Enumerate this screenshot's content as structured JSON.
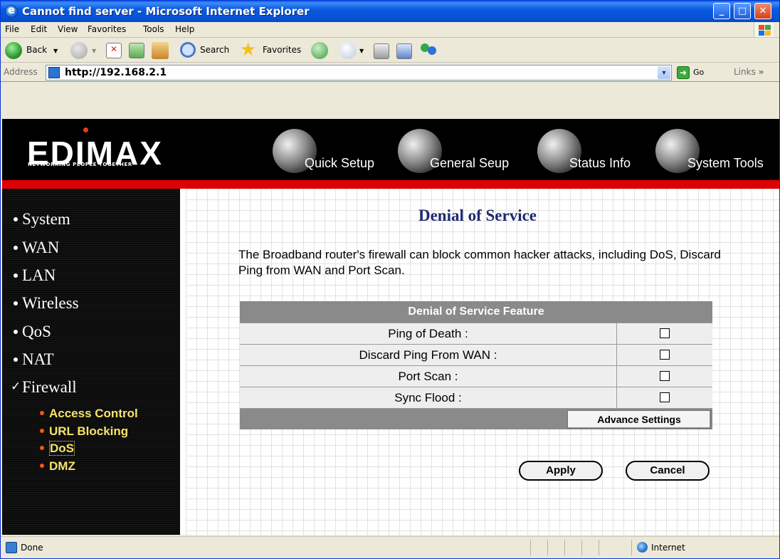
{
  "window": {
    "title": "Cannot find server - Microsoft Internet Explorer"
  },
  "menu": [
    "File",
    "Edit",
    "View",
    "Favorites",
    "Tools",
    "Help"
  ],
  "toolbar": {
    "back": "Back",
    "search": "Search",
    "favorites": "Favorites"
  },
  "address": {
    "label": "Address",
    "url": "http://192.168.2.1",
    "go": "Go",
    "links": "Links"
  },
  "router": {
    "logo": "EDIMAX",
    "tagline": "NETWORKING PEOPLE TOGETHER",
    "nav": [
      "Quick Setup",
      "General Seup",
      "Status Info",
      "System Tools"
    ]
  },
  "sidebar": {
    "items": [
      "System",
      "WAN",
      "LAN",
      "Wireless",
      "QoS",
      "NAT",
      "Firewall"
    ],
    "sub_items": [
      "Access Control",
      "URL Blocking",
      "DoS",
      "DMZ"
    ]
  },
  "page": {
    "title": "Denial of Service",
    "description": "The Broadband router's firewall can block common hacker attacks, including DoS, Discard Ping from WAN and Port Scan.",
    "table_header": "Denial of Service Feature",
    "features": [
      {
        "label": "Ping of Death :",
        "checked": false
      },
      {
        "label": "Discard Ping From WAN :",
        "checked": false
      },
      {
        "label": "Port Scan :",
        "checked": false
      },
      {
        "label": "Sync Flood :",
        "checked": false
      }
    ],
    "advance_button": "Advance Settings",
    "apply_button": "Apply",
    "cancel_button": "Cancel"
  },
  "status": {
    "text": "Done",
    "zone": "Internet"
  }
}
